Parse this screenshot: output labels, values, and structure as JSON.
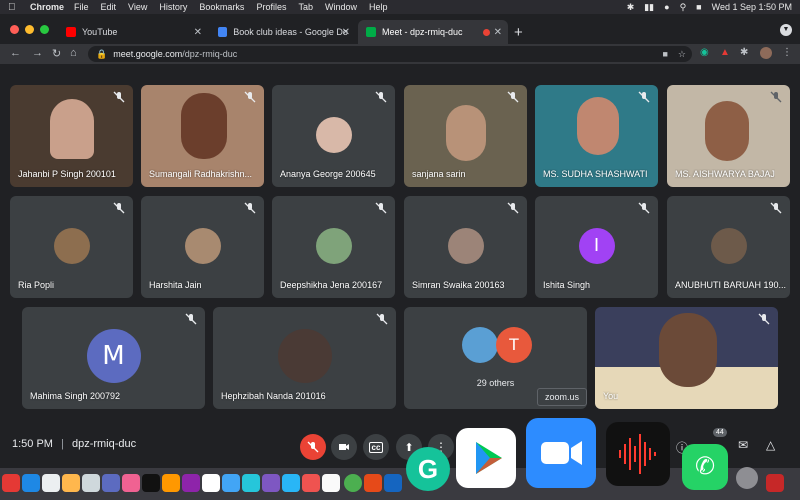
{
  "menubar": {
    "app": "Chrome",
    "items": [
      "File",
      "Edit",
      "View",
      "History",
      "Bookmarks",
      "Profiles",
      "Tab",
      "Window",
      "Help"
    ],
    "datetime": "Wed 1 Sep  1:50 PM"
  },
  "tabs": [
    {
      "label": "YouTube",
      "favicon_color": "#ff0000"
    },
    {
      "label": "Book club ideas - Google Docs",
      "favicon_color": "#4285f4"
    },
    {
      "label": "Meet - dpz-rmiq-duc",
      "favicon_color": "#00ac47"
    }
  ],
  "omnibox": {
    "host": "meet.google.com",
    "path": "/dpz-rmiq-duc"
  },
  "participants": [
    {
      "name": "Jahanbi P Singh 200101"
    },
    {
      "name": "Sumangali Radhakrishn..."
    },
    {
      "name": "Ananya George 200645"
    },
    {
      "name": "sanjana sarin"
    },
    {
      "name": "MS. SUDHA SHASHWATI"
    },
    {
      "name": "MS. AISHWARYA BAJAJ"
    },
    {
      "name": "Ria Popli"
    },
    {
      "name": "Harshita Jain"
    },
    {
      "name": "Deepshikha Jena 200167"
    },
    {
      "name": "Simran Swaika 200163"
    },
    {
      "name": "Ishita Singh",
      "initial": "I",
      "color": "#a142f4"
    },
    {
      "name": "ANUBHUTI BARUAH 190..."
    },
    {
      "name": "Mahima Singh 200792",
      "initial": "M",
      "color": "#5c6bc0"
    },
    {
      "name": "Hephzibah Nanda 201016"
    },
    {
      "name": "You"
    }
  ],
  "others": {
    "label": "29 others",
    "initial": "T",
    "color": "#e8593c"
  },
  "tooltip": "zoom.us",
  "bottom": {
    "time": "1:50 PM",
    "separator": "|",
    "meeting_code": "dpz-rmiq-duc",
    "badge": "44"
  },
  "colors": {
    "accent_red": "#ea4335",
    "tile_bg": "#3c4043",
    "page_bg": "#202124"
  }
}
